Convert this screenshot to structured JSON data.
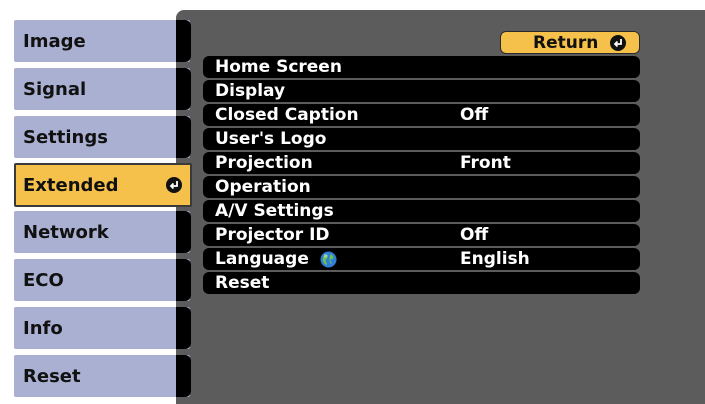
{
  "sidebar": {
    "tabs": [
      {
        "label": "Image"
      },
      {
        "label": "Signal"
      },
      {
        "label": "Settings"
      },
      {
        "label": "Extended"
      },
      {
        "label": "Network"
      },
      {
        "label": "ECO"
      },
      {
        "label": "Info"
      },
      {
        "label": "Reset"
      }
    ],
    "active_index": 3
  },
  "return_button": {
    "label": "Return"
  },
  "menu": {
    "items": [
      {
        "label": "Home Screen",
        "value": ""
      },
      {
        "label": "Display",
        "value": ""
      },
      {
        "label": "Closed Caption",
        "value": "Off"
      },
      {
        "label": "User's Logo",
        "value": ""
      },
      {
        "label": "Projection",
        "value": "Front"
      },
      {
        "label": "Operation",
        "value": ""
      },
      {
        "label": "A/V Settings",
        "value": ""
      },
      {
        "label": "Projector ID",
        "value": "Off"
      },
      {
        "label": "Language",
        "value": "English",
        "icon": "globe-icon"
      },
      {
        "label": "Reset",
        "value": ""
      }
    ]
  },
  "colors": {
    "panel_bg": "#5c5c5c",
    "tab_bg": "#aab0d2",
    "active_bg": "#f5c14a",
    "row_bg": "#000000",
    "text_light": "#ffffff"
  }
}
